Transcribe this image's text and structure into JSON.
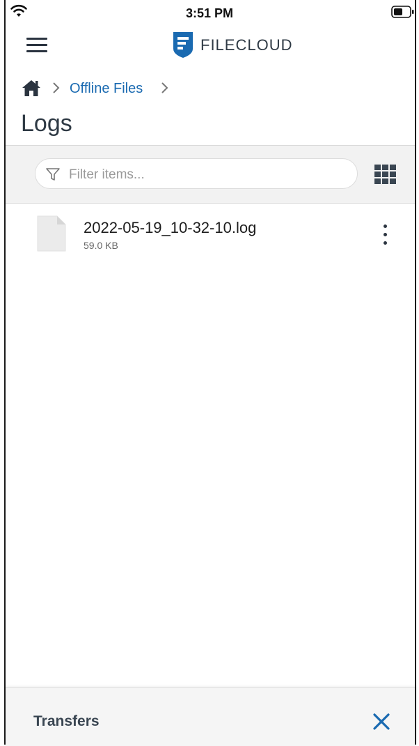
{
  "status_bar": {
    "time": "3:51 PM",
    "wifi_icon": "wifi-icon",
    "battery_icon": "battery-icon"
  },
  "header": {
    "menu_icon": "hamburger-menu-icon",
    "brand_name_light": "FILE",
    "brand_name_bold": "CLOUD",
    "brand_color": "#1a6ab1"
  },
  "breadcrumb": {
    "home_icon": "home-icon",
    "items": [
      {
        "label": "Offline Files"
      }
    ]
  },
  "page": {
    "title": "Logs"
  },
  "filter": {
    "placeholder": "Filter items...",
    "filter_icon": "filter-icon",
    "view_toggle_icon": "grid-view-icon"
  },
  "files": [
    {
      "name": "2022-05-19_10-32-10.log",
      "size": "59.0 KB",
      "icon": "file-icon",
      "menu_icon": "more-vertical-icon"
    }
  ],
  "transfers": {
    "label": "Transfers",
    "close_icon": "close-icon",
    "accent": "#1a6ab1"
  }
}
